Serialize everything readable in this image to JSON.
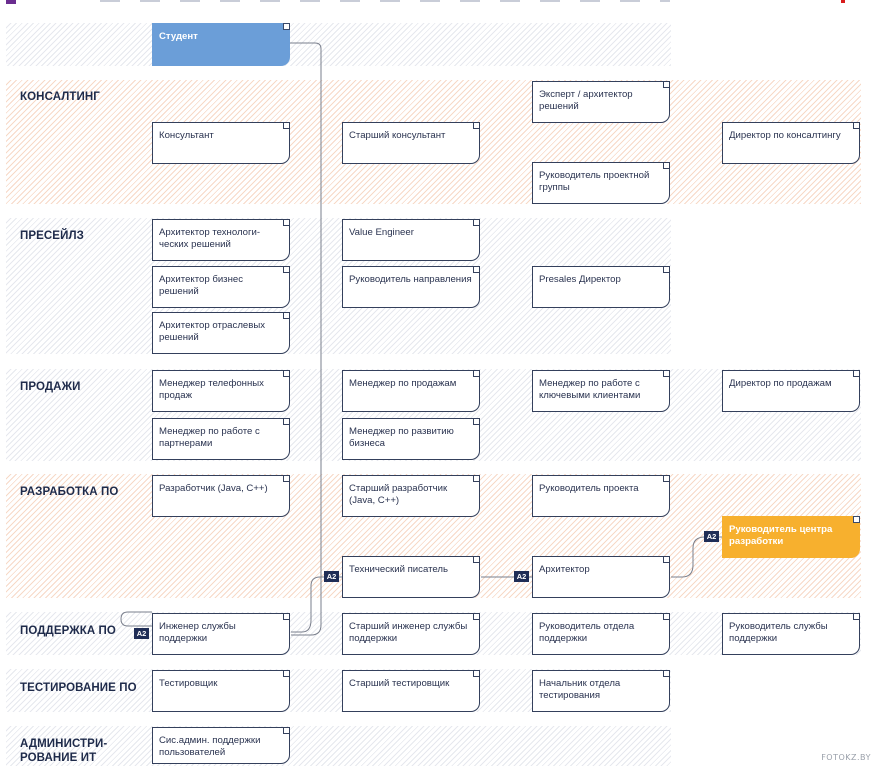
{
  "sections": {
    "consulting": "КОНСАЛТИНГ",
    "presales": "ПРЕСЕЙЛЗ",
    "sales": "ПРОДАЖИ",
    "dev": "РАЗРАБОТКА ПО",
    "support": "ПОДДЕРЖКА ПО",
    "testing": "ТЕСТИРОВАНИЕ ПО",
    "admin_line1": "АДМИНИСТРИ-",
    "admin_line2": "РОВАНИЕ ИТ"
  },
  "roles": {
    "student": "Студент",
    "consultant": "Консультант",
    "senior_consultant": "Старший консультант",
    "expert_architect": "Эксперт / архитектор решений",
    "project_group_lead": "Руководитель проектной группы",
    "consulting_director": "Директор по консалтингу",
    "tech_solutions_architect": "Архитектор технологи-ческих решений",
    "business_solutions_architect": "Архитектор бизнес решений",
    "industry_solutions_architect": "Архитектор отраслевых решений",
    "value_engineer": "Value Engineer",
    "direction_head": "Руководитель направления",
    "presales_director": "Presales Директор",
    "phone_sales_manager": "Менеджер телефонных продаж",
    "partner_manager": "Менеджер по работе с партнерами",
    "sales_manager": "Менеджер по продажам",
    "biz_dev_manager": "Менеджер по развитию бизнеса",
    "key_account_manager": "Менеджер по работе с ключевыми клиентами",
    "sales_director": "Директор по продажам",
    "developer": "Разработчик (Java, C++)",
    "senior_developer": "Старший разработчик (Java, C++)",
    "project_manager": "Руководитель проекта",
    "dev_center_head": "Руководитель центра разработки",
    "tech_writer": "Технический писатель",
    "architect": "Архитектор",
    "support_engineer": "Инженер службы поддержки",
    "senior_support_engineer": "Старший инженер службы поддержки",
    "support_dept_head": "Руководитель отдела поддержки",
    "support_service_head": "Руководитель службы поддержки",
    "tester": "Тестировщик",
    "senior_tester": "Старший тестировщик",
    "testing_dept_head": "Начальник отдела тестирования",
    "sysadmin": "Сис.админ. поддержки пользователей"
  },
  "badges": {
    "a2": "A2"
  },
  "watermark": "FOTOKZ.BY",
  "colors": {
    "navy": "#1f2d56",
    "orange": "#f7b02e",
    "blue": "#6b9ed8",
    "hatch_orange": "#f7d9c7",
    "hatch_gray": "#e6e8ee"
  }
}
